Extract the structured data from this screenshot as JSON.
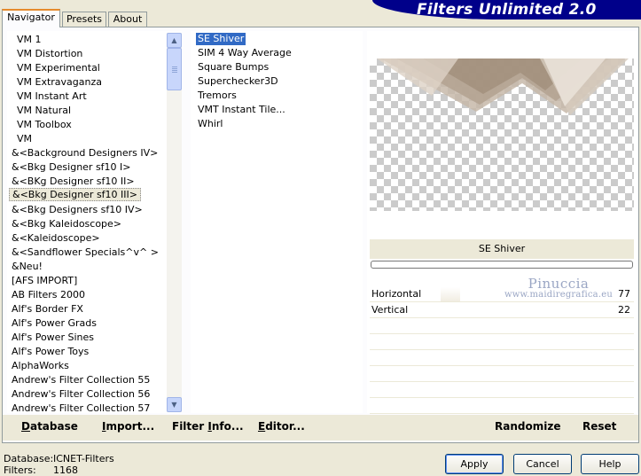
{
  "banner": {
    "title": "Filters Unlimited 2.0"
  },
  "tabs": [
    "Navigator",
    "Presets",
    "About"
  ],
  "categories": [
    "VM 1",
    "VM Distortion",
    "VM Experimental",
    "VM Extravaganza",
    "VM Instant Art",
    "VM Natural",
    "VM Toolbox",
    "VM",
    "&<Background Designers IV>",
    "&<Bkg Designer sf10 I>",
    "&<BKg Designer sf10 II>",
    "&<Bkg Designer sf10 III>",
    "&<Bkg Designers sf10 IV>",
    "&<Bkg Kaleidoscope>",
    "&<Kaleidoscope>",
    "&<Sandflower Specials^v^ >",
    "&Neu!",
    "[AFS IMPORT]",
    "AB Filters 2000",
    "Alf's Border FX",
    "Alf's Power Grads",
    "Alf's Power Sines",
    "Alf's Power Toys",
    "AlphaWorks",
    "Andrew's Filter Collection 55",
    "Andrew's Filter Collection 56",
    "Andrew's Filter Collection 57"
  ],
  "selected_category": "&<Bkg Designer sf10 III>",
  "filters": [
    "SE Shiver",
    "SIM 4 Way Average",
    "Square Bumps",
    "Superchecker3D",
    "Tremors",
    "VMT Instant Tile...",
    "Whirl"
  ],
  "selected_filter": "SE Shiver",
  "preview": {
    "filter_name": "SE Shiver"
  },
  "params": [
    {
      "label": "Horizontal",
      "value": "77"
    },
    {
      "label": "Vertical",
      "value": "22"
    }
  ],
  "watermark": {
    "line1": "Pinuccia",
    "line2": "www.maidiregrafica.eu"
  },
  "bottom_buttons": {
    "database": {
      "pre": "",
      "u": "D",
      "post": "atabase"
    },
    "import": {
      "pre": "",
      "u": "I",
      "post": "mport..."
    },
    "filter_info": {
      "pre": "Filter ",
      "u": "I",
      "post": "nfo..."
    },
    "editor": {
      "pre": "",
      "u": "E",
      "post": "ditor..."
    },
    "randomize": "Randomize",
    "reset": "Reset"
  },
  "status": {
    "database_label": "Database:",
    "database_value": "ICNET-Filters",
    "filters_label": "Filters:",
    "filters_value": "1168"
  },
  "dialog_buttons": {
    "apply": "Apply",
    "cancel": "Cancel",
    "help": "Help"
  },
  "colors": {
    "banner": "#00008a",
    "selection": "#316ac5",
    "face": "#ece9d8"
  }
}
